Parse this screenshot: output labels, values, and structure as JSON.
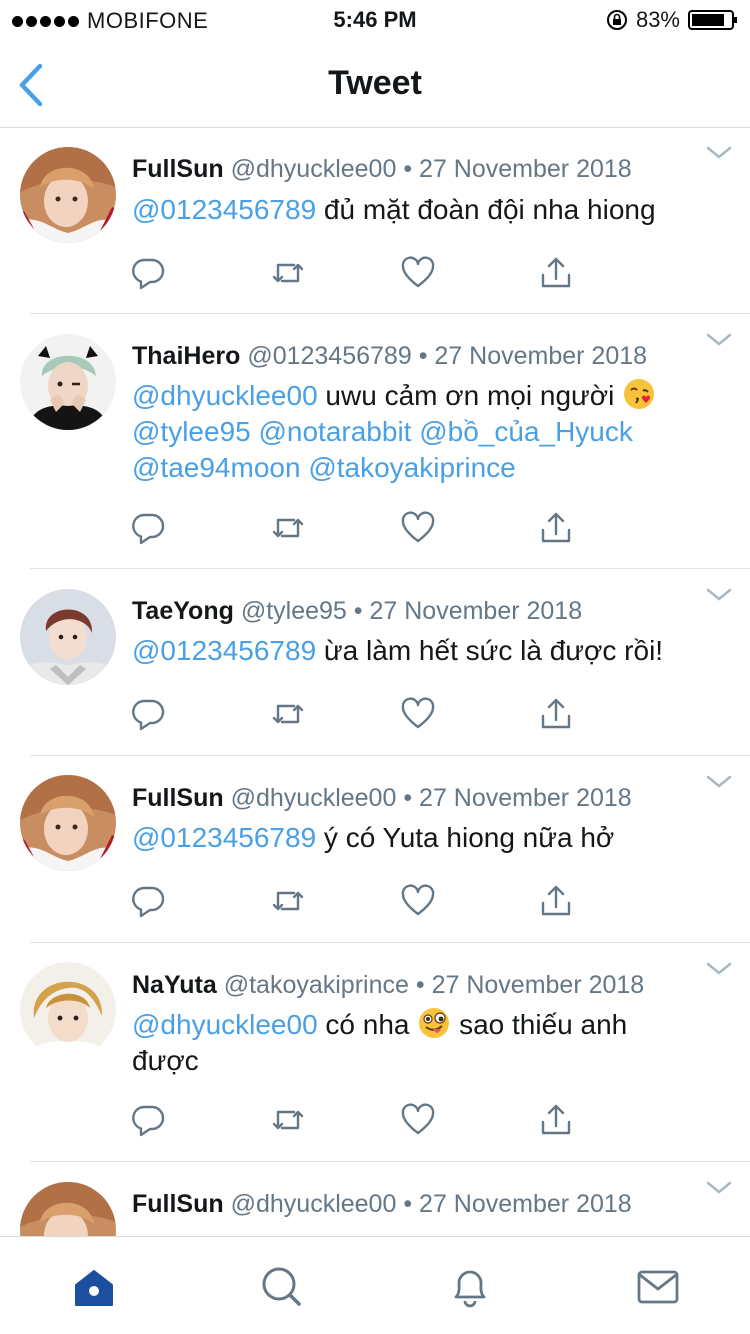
{
  "status_bar": {
    "carrier": "MOBIFONE",
    "time": "5:46 PM",
    "battery": "83%"
  },
  "nav": {
    "title": "Tweet",
    "back_icon": "chevron-left-icon"
  },
  "colors": {
    "accent": "#4aa0e6",
    "tab_active": "#1c4fa0",
    "muted": "#657786",
    "divider": "#e1e6ea"
  },
  "tweets": [
    {
      "name": "FullSun",
      "handle": "@dhyucklee00",
      "date": "27 November 2018",
      "mention": "@0123456789",
      "text": " đủ mặt đoàn đội nha hiong"
    },
    {
      "name": "ThaiHero",
      "handle": "@0123456789",
      "date": "27 November 2018",
      "mention": "@dhyucklee00",
      "text": " uwu cảm ơn mọi người ",
      "mentions_line2": "@tylee95 @notarabbit @bồ_của_Hyuck",
      "mentions_line3": "@tae94moon @takoyakiprince",
      "emoji": "kissing-face-emoji"
    },
    {
      "name": "TaeYong",
      "handle": "@tylee95",
      "date": "27 November 2018",
      "mention": "@0123456789",
      "text": " ừa làm hết sức là được rồi!"
    },
    {
      "name": "FullSun",
      "handle": "@dhyucklee00",
      "date": "27 November 2018",
      "mention": "@0123456789",
      "text": " ý có Yuta hiong nữa hở"
    },
    {
      "name": "NaYuta",
      "handle": "@takoyakiprince",
      "date": "27 November 2018",
      "mention": "@dhyucklee00",
      "text": " có nha ",
      "text_after_emoji": " sao thiếu anh",
      "text_line2": "được",
      "emoji": "winking-tongue-emoji"
    },
    {
      "name": "FullSun",
      "handle": "@dhyucklee00",
      "date": "27 November 2018"
    }
  ],
  "sep": "•",
  "tabs": [
    "home-icon",
    "search-icon",
    "bell-icon",
    "mail-icon"
  ]
}
